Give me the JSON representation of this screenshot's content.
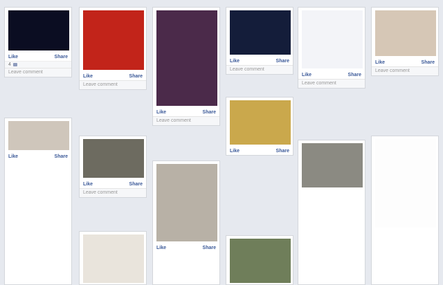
{
  "labels": {
    "like": "Like",
    "share": "Share",
    "leave": "Leave comment"
  },
  "cards": {
    "c1": {
      "name": "",
      "likes": "4"
    },
    "c2": {
      "name": "",
      "likes": ""
    },
    "c3": {
      "name": "",
      "likes": ""
    },
    "c4": {
      "name": "",
      "likes": ""
    },
    "c5": {
      "name": "",
      "likes": ""
    },
    "c6": {
      "name": "",
      "likes": ""
    },
    "c7": {
      "name": "",
      "likes": ""
    },
    "c8": {
      "name": "",
      "likes": ""
    },
    "c9": {
      "name": "",
      "likes": ""
    },
    "c10": {
      "name": "",
      "likes": ""
    },
    "c11": {
      "name": "",
      "likes": ""
    },
    "c12": {
      "name": "",
      "likes": ""
    },
    "c13": {
      "name": "",
      "likes": ""
    },
    "c14": {
      "name": "",
      "likes": ""
    },
    "c15": {
      "name": "",
      "likes": ""
    }
  }
}
